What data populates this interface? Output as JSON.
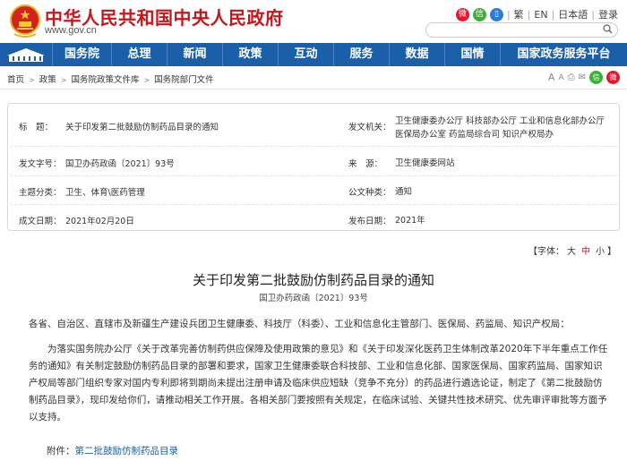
{
  "header": {
    "site_title": "中华人民共和国中央人民政府",
    "site_domain": "www.gov.cn",
    "top_links": [
      "繁",
      "EN",
      "日本語",
      "登录"
    ],
    "search_button": "Q"
  },
  "nav": {
    "items": [
      "国务院",
      "总理",
      "新闻",
      "政策",
      "互动",
      "服务",
      "数据",
      "国情",
      "国家政务服务平台"
    ]
  },
  "breadcrumb": {
    "items": [
      "首页",
      "政策",
      "国务院政策文件库",
      "国务院部门文件"
    ]
  },
  "info": {
    "title_label": "标　题：",
    "title_value": "关于印发第二批鼓励仿制药品目录的通知",
    "issuer_label": "发文机关：",
    "issuer_value": "卫生健康委办公厅  科技部办公厅  工业和信息化部办公厅  医保局办公室  药监局综合司  知识产权局办",
    "doc_no_label": "发文字号：",
    "doc_no_value": "国卫办药政函〔2021〕93号",
    "source_label": "来　源：",
    "source_value": "卫生健康委网站",
    "category_label": "主题分类：",
    "category_value": "卫生、体育\\医药管理",
    "genre_label": "公文种类：",
    "genre_value": "通知",
    "written_label": "成文日期：",
    "written_value": "2021年02月20日",
    "published_label": "发布日期：",
    "published_value": "2021年"
  },
  "font_size": {
    "label": "【字体：",
    "large": "大",
    "medium": "中",
    "small": "小",
    "close": "】"
  },
  "article": {
    "title": "关于印发第二批鼓励仿制药品目录的通知",
    "doc_no": "国卫办药政函〔2021〕93号",
    "salutation": "各省、自治区、直辖市及新疆生产建设兵团卫生健康委、科技厅（科委）、工业和信息化主管部门、医保局、药监局、知识产权局：",
    "body": "为落实国务院办公厅《关于改革完善仿制药供应保障及使用政策的意见》和《关于印发深化医药卫生体制改革2020年下半年重点工作任务的通知》有关制定鼓励仿制药品目录的部署和要求，国家卫生健康委联合科技部、工业和信息化部、国家医保局、国家药监局、国家知识产权局等部门组织专家对国内专利即将到期尚未提出注册申请及临床供应短缺（竞争不充分）的药品进行遴选论证，制定了《第二批鼓励仿制药品目录》，现印发给你们，请推动相关工作开展。各相关部门要按照有关规定，在临床试验、关键共性技术研究、优先审评审批等方面予以支持。",
    "attachment_label": "附件：",
    "attachment_link": "第二批鼓励仿制药品目录"
  },
  "colors": {
    "brand_red": "#c8161d",
    "nav_blue": "#1a5fa8"
  }
}
